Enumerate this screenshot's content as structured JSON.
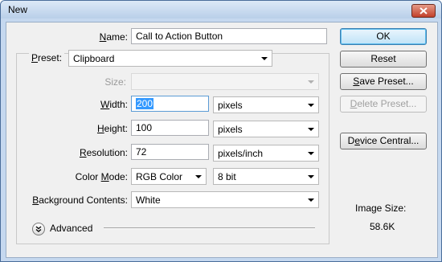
{
  "window": {
    "title": "New"
  },
  "name": {
    "label": "Name:",
    "value": "Call to Action Button"
  },
  "preset": {
    "label": "Preset:",
    "value": "Clipboard"
  },
  "size": {
    "label": "Size:",
    "value": ""
  },
  "width": {
    "label": "Width:",
    "value": "200",
    "unit": "pixels"
  },
  "height": {
    "label": "Height:",
    "value": "100",
    "unit": "pixels"
  },
  "resolution": {
    "label": "Resolution:",
    "value": "72",
    "unit": "pixels/inch"
  },
  "color_mode": {
    "label": "Color Mode:",
    "value": "RGB Color",
    "depth": "8 bit"
  },
  "background": {
    "label": "Background Contents:",
    "value": "White"
  },
  "advanced": {
    "label": "Advanced"
  },
  "buttons": {
    "ok": "OK",
    "reset": "Reset",
    "save_preset": "Save Preset...",
    "delete_preset": "Delete Preset...",
    "device_central": "Device Central..."
  },
  "image_size": {
    "label": "Image Size:",
    "value": "58.6K"
  }
}
